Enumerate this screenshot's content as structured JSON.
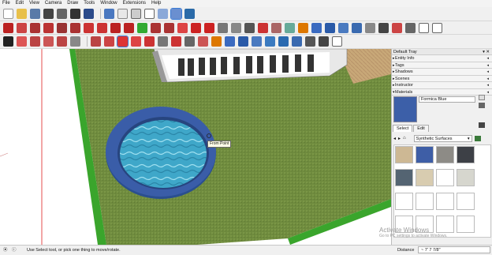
{
  "menu": [
    "File",
    "Edit",
    "View",
    "Camera",
    "Draw",
    "Tools",
    "Window",
    "Extensions",
    "Help"
  ],
  "tray": {
    "title": "Default Tray",
    "panels": [
      "Entity Info",
      "Tags",
      "Shadows",
      "Scenes",
      "Instructor",
      "Materials"
    ],
    "material_name": "Formica Blue",
    "tabs": [
      "Select",
      "Edit"
    ],
    "library": "Synthetic Surfaces",
    "swatches": [
      "#cdb894",
      "#3e5ea6",
      "#8d8b86",
      "#3d4046",
      "#546472",
      "#d8ccb0",
      "#ffffff",
      "#d6d6ce",
      "#ffffff",
      "#ffffff",
      "#ffffff",
      "#ffffff",
      "#ffffff",
      "#ffffff",
      "#ffffff",
      "#ffffff"
    ]
  },
  "viewport": {
    "tooltip": "From Point",
    "colors": {
      "grass": "#6f8b3e",
      "lawn_edge": "#3aa52c",
      "pool_rim": "#3a5da8",
      "water": "#3fa7c9",
      "axis_red": "#e02020"
    }
  },
  "status": {
    "message": "Use Select tool, or pick one thing to move/rotate.",
    "distance_label": "Distance",
    "distance_value": "~ 7' 7 7/8\""
  },
  "watermark": {
    "title": "Activate Windows",
    "subtitle": "Go to PC settings to activate Windows."
  }
}
